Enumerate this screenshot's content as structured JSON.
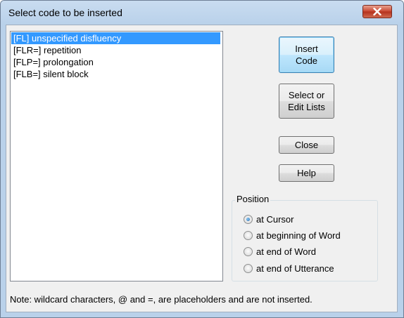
{
  "window": {
    "title": "Select code to be inserted"
  },
  "list": {
    "items": [
      {
        "label": "[FL] unspecified disfluency",
        "selected": true
      },
      {
        "label": "[FLR=] repetition",
        "selected": false
      },
      {
        "label": "[FLP=] prolongation",
        "selected": false
      },
      {
        "label": "[FLB=] silent block",
        "selected": false
      }
    ]
  },
  "buttons": {
    "insert_line1": "Insert",
    "insert_line2": "Code",
    "select_line1": "Select or",
    "select_line2": "Edit Lists",
    "close": "Close",
    "help": "Help"
  },
  "position": {
    "label": "Position",
    "options": [
      {
        "label": "at Cursor",
        "checked": true
      },
      {
        "label": "at beginning of Word",
        "checked": false
      },
      {
        "label": "at end of Word",
        "checked": false
      },
      {
        "label": "at end of Utterance",
        "checked": false
      }
    ]
  },
  "note": "Note: wildcard characters, @ and =, are placeholders and are not inserted.",
  "colors": {
    "selection": "#3399ff",
    "titlebar": "#b9d1ea",
    "close_button": "#c7452f"
  }
}
